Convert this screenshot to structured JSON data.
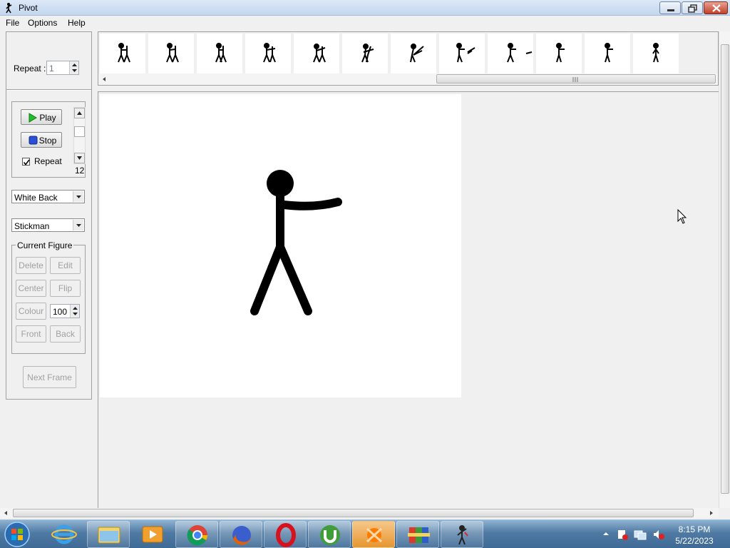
{
  "window": {
    "title": "Pivot",
    "icon": "stickman-icon"
  },
  "menu": [
    "File",
    "Options",
    "Help"
  ],
  "left_panel": {
    "repeat_label": "Repeat :",
    "repeat_value": "1",
    "play_label": "Play",
    "stop_label": "Stop",
    "repeat_checkbox_label": "Repeat",
    "repeat_checked": true,
    "speed_value": "12",
    "background_select": "White Back",
    "figure_select": "Stickman",
    "current_figure": {
      "title": "Current Figure",
      "delete_label": "Delete",
      "edit_label": "Edit",
      "center_label": "Center",
      "flip_label": "Flip",
      "colour_label": "Colour",
      "opacity_value": "100",
      "front_label": "Front",
      "back_label": "Back"
    },
    "next_frame_label": "Next Frame"
  },
  "frame_strip": {
    "frame_count": 12
  },
  "taskbar": {
    "apps": [
      "start-orb-icon",
      "internet-explorer-icon",
      "file-explorer-icon",
      "media-player-icon",
      "chrome-icon",
      "firefox-icon",
      "opera-icon",
      "utorrent-icon",
      "avast-icon",
      "winrar-icon",
      "pivot-icon"
    ],
    "time": "8:15 PM",
    "date": "5/22/2023"
  }
}
